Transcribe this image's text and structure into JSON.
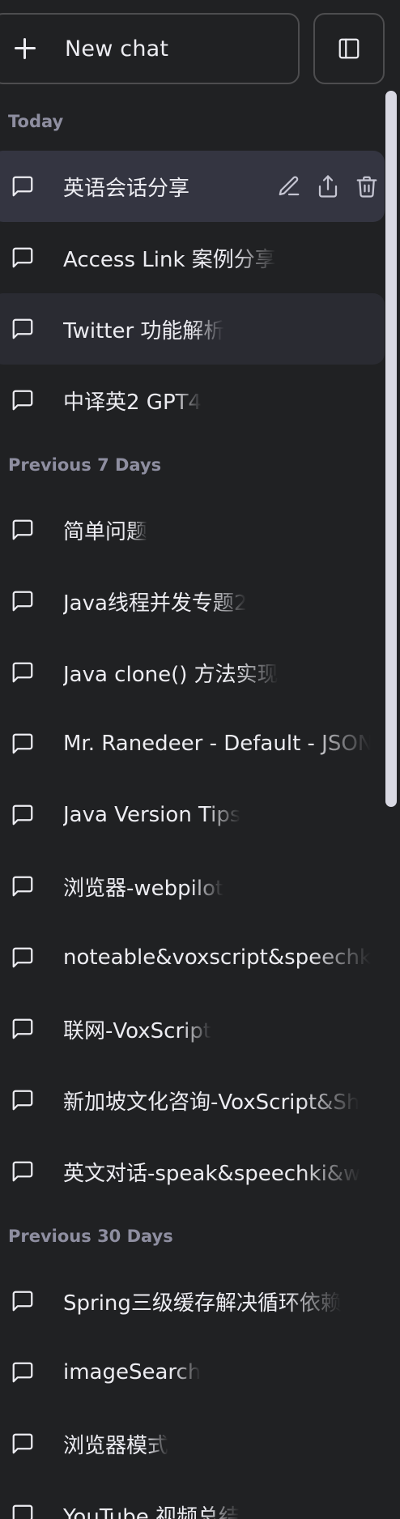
{
  "top": {
    "new_chat_label": "New chat",
    "new_chat_icon": "plus-icon",
    "toggle_icon": "sidebar-toggle-icon"
  },
  "sections": {
    "today": "Today",
    "previous_7": "Previous 7 Days",
    "previous_30": "Previous 30 Days"
  },
  "chats": [
    {
      "title": "英语会话分享",
      "state": "selected",
      "actions": [
        "edit-icon",
        "share-icon",
        "delete-icon"
      ]
    },
    {
      "title": "Access Link 案例分享"
    },
    {
      "title": "Twitter 功能解析",
      "state": "hover"
    },
    {
      "title": "中译英2 GPT4"
    },
    {
      "title": "简单问题"
    },
    {
      "title": "Java线程并发专题2"
    },
    {
      "title": "Java clone() 方法实现"
    },
    {
      "title": "Mr. Ranedeer - Default - JSON"
    },
    {
      "title": "Java Version Tips"
    },
    {
      "title": "浏览器-webpilot"
    },
    {
      "title": "noteable&voxscript&speechki"
    },
    {
      "title": "联网-VoxScript"
    },
    {
      "title": "新加坡文化咨询-VoxScript&Sh"
    },
    {
      "title": "英文对话-speak&speechki&w"
    },
    {
      "title": "Spring三级缓存解决循环依赖"
    },
    {
      "title": "imageSearch"
    },
    {
      "title": "浏览器模式"
    },
    {
      "title": "YouTube 视频总结"
    }
  ],
  "colors": {
    "background": "#202123",
    "selected_row": "#343541",
    "hover_row": "#2a2b32",
    "section_label": "#8e8ea0",
    "text": "#ececf1",
    "border": "#4d4d4f",
    "scrollbar_thumb": "#d9d9e3"
  }
}
